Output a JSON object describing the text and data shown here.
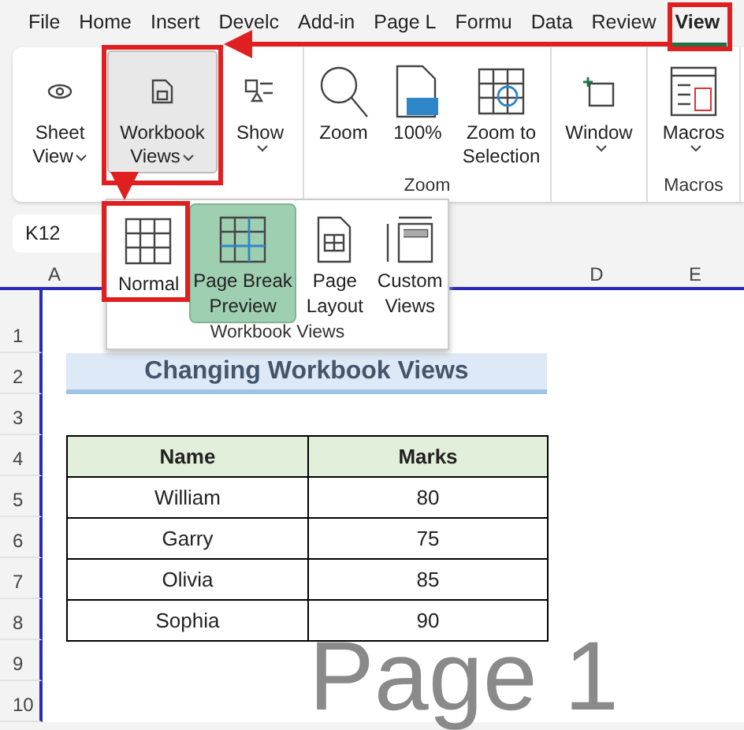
{
  "tabs": [
    {
      "label": "File",
      "selected": false
    },
    {
      "label": "Home",
      "selected": false
    },
    {
      "label": "Insert",
      "selected": false
    },
    {
      "label": "Develc",
      "selected": false
    },
    {
      "label": "Add-in",
      "selected": false
    },
    {
      "label": "Page L",
      "selected": false
    },
    {
      "label": "Formu",
      "selected": false
    },
    {
      "label": "Data",
      "selected": false
    },
    {
      "label": "Review",
      "selected": false
    },
    {
      "label": "View",
      "selected": true
    }
  ],
  "ribbon": {
    "groups": [
      {
        "buttons": [
          {
            "kind": "eye",
            "lines": [
              "Sheet",
              "View"
            ],
            "dropdown": true,
            "selected": false
          },
          {
            "kind": "doc",
            "lines": [
              "Workbook",
              "Views"
            ],
            "dropdown": true,
            "selected": true
          },
          {
            "kind": "shapes",
            "lines": [
              "Show"
            ],
            "dropdown": true,
            "selected": false
          }
        ]
      },
      {
        "label": "Zoom",
        "buttons": [
          {
            "kind": "magnifier",
            "lines": [
              "Zoom"
            ],
            "dropdown": false,
            "selected": false
          },
          {
            "kind": "hundred",
            "lines": [
              "100%"
            ],
            "dropdown": false,
            "selected": false
          },
          {
            "kind": "zoom-selection",
            "lines": [
              "Zoom to",
              "Selection"
            ],
            "dropdown": false,
            "selected": false
          }
        ]
      },
      {
        "buttons": [
          {
            "kind": "window",
            "lines": [
              "Window"
            ],
            "dropdown": true,
            "selected": false
          }
        ]
      },
      {
        "label": "Macros",
        "buttons": [
          {
            "kind": "macros",
            "lines": [
              "Macros"
            ],
            "dropdown": true,
            "selected": false
          }
        ]
      }
    ]
  },
  "workbook_views_menu": {
    "items": [
      {
        "kind": "normal",
        "lines": [
          "Normal"
        ],
        "selected": false
      },
      {
        "kind": "page-break",
        "lines": [
          "Page Break",
          "Preview"
        ],
        "selected": true
      },
      {
        "kind": "page-layout",
        "lines": [
          "Page",
          "Layout"
        ],
        "selected": false
      },
      {
        "kind": "custom",
        "lines": [
          "Custom",
          "Views"
        ],
        "selected": false
      }
    ],
    "label": "Workbook Views"
  },
  "name_box": "K12",
  "sheet": {
    "columns": [
      "A",
      "D",
      "E"
    ],
    "rows": [
      "1",
      "2",
      "3",
      "4",
      "5",
      "6",
      "7",
      "8",
      "9",
      "10"
    ],
    "title": "Changing Workbook Views",
    "table": {
      "columns": [
        "Name",
        "Marks"
      ],
      "rows": [
        [
          "William",
          "80"
        ],
        [
          "Garry",
          "75"
        ],
        [
          "Olivia",
          "85"
        ],
        [
          "Sophia",
          "90"
        ]
      ]
    },
    "page_label": "Page 1"
  }
}
